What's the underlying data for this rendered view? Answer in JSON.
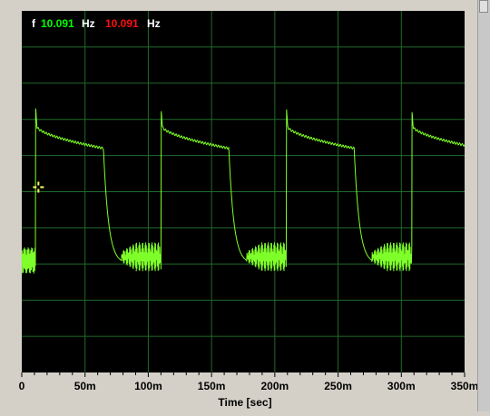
{
  "readout": {
    "f_label": "f",
    "ch1_value": "10.091",
    "ch1_unit": "Hz",
    "ch2_value": "10.091",
    "ch2_unit": "Hz"
  },
  "colors": {
    "background": "#000000",
    "grid": "#1f6b2a",
    "trace": "#7fff2a",
    "ch1_text": "#00ff00",
    "ch2_text": "#ff1010",
    "unit_text": "#ffffff",
    "cursor": "#ffff66",
    "frame": "#d4d0c8"
  },
  "chart_data": {
    "type": "line",
    "title": "",
    "xlabel": "Time [sec]",
    "ylabel": "",
    "x_ticks": [
      "0",
      "50m",
      "100m",
      "150m",
      "200m",
      "250m",
      "300m",
      "350m"
    ],
    "xlim": [
      0,
      350
    ],
    "x_unit": "ms",
    "y_divisions": 10,
    "grid": true,
    "series": [
      {
        "period_ms": 99.1,
        "first_rise_ms": 11,
        "high_plateau_start_div": 6.8,
        "high_plateau_end_div": 6.2,
        "low_level_div": 3.1,
        "ringing_amplitude_div": 0.4,
        "fall_time_ms": 14
      }
    ],
    "cursor_marker": {
      "x": 11,
      "y_div": 5.0
    }
  }
}
